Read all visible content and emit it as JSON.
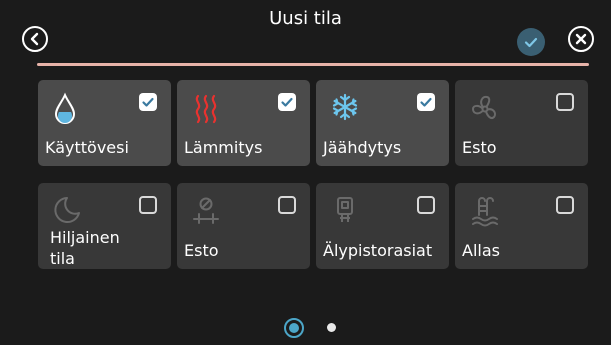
{
  "header": {
    "title": "Uusi tila"
  },
  "colors": {
    "accent_line": "#e7b3a9",
    "confirm_bg": "#3a5f72",
    "page_dot_active": "#4ca6c8",
    "heating_icon": "#e8322f",
    "water_icon": "#5fb6e0",
    "cooling_icon": "#6cc6ee"
  },
  "tiles": [
    {
      "label": "Käyttövesi",
      "checked": true,
      "icon": "water-drop-icon"
    },
    {
      "label": "Lämmitys",
      "checked": true,
      "icon": "heating-icon"
    },
    {
      "label": "Jäähdytys",
      "checked": true,
      "icon": "snowflake-icon"
    },
    {
      "label": "Esto",
      "checked": false,
      "icon": "fan-icon"
    },
    {
      "label": "Hiljainen tila",
      "checked": false,
      "icon": "moon-icon"
    },
    {
      "label": "Esto",
      "checked": false,
      "icon": "block-icon"
    },
    {
      "label": "Älypistorasiat",
      "checked": false,
      "icon": "smart-plug-icon"
    },
    {
      "label": "Allas",
      "checked": false,
      "icon": "pool-icon"
    }
  ],
  "pagination": {
    "current": 1,
    "total": 2
  }
}
